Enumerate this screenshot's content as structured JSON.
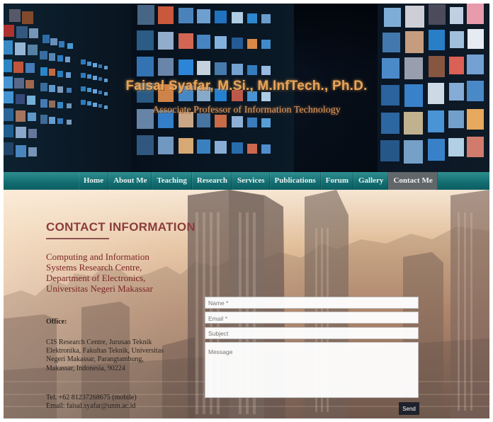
{
  "header": {
    "title": "Faisal Syafar, M.Si., M.InfTech., Ph.D.",
    "subtitle": "Associate Professor of Information Technology"
  },
  "nav": {
    "items": [
      {
        "label": "Home"
      },
      {
        "label": "About Me"
      },
      {
        "label": "Teaching"
      },
      {
        "label": "Research"
      },
      {
        "label": "Services"
      },
      {
        "label": "Publications"
      },
      {
        "label": "Forum"
      },
      {
        "label": "Gallery"
      },
      {
        "label": "Contact Me"
      }
    ],
    "active_label": "Contact Me"
  },
  "contact": {
    "heading": "CONTACT INFORMATION",
    "organization": "Computing and Information Systems Research Centre, Department of Electronics, Universitas Negeri Makassar",
    "office_label": "Office:",
    "address": "CIS Research Centre, Jurusan Teknik Elektronika, Fakultas Teknik, Universitas Negeri Makassar, Parangtambung, Makassar, Indonesia, 90224",
    "phone": "Tel. +62 81237268675 (mobile)",
    "email": "Email: faisal.syafar@unm.ac.id"
  },
  "form": {
    "name_placeholder": "Name *",
    "email_placeholder": "Email *",
    "subject_placeholder": "Subject",
    "message_placeholder": "Message",
    "send_label": "Send"
  },
  "colors": {
    "nav_background": "#126d71",
    "nav_active": "#616668",
    "heading_text": "#8b3c3d",
    "organization_text": "#7b2525",
    "send_button": "#20222b"
  }
}
